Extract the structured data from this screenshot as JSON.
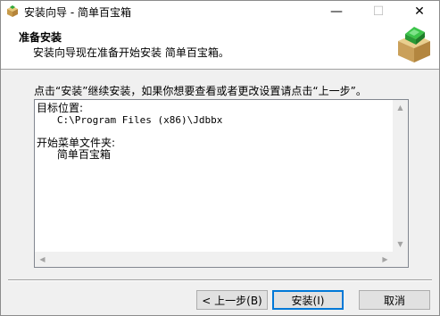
{
  "window": {
    "title": "安装向导 - 简单百宝箱",
    "controls": {
      "minimize": "—",
      "maximize": "☐",
      "close": "✕"
    }
  },
  "header": {
    "title": "准备安装",
    "subtitle": "安装向导现在准备开始安装 简单百宝箱。",
    "logo_icon": "install-box-icon"
  },
  "body": {
    "instruction": "点击“安装”继续安装，如果你想要查看或者更改设置请点击“上一步”。",
    "summary": {
      "dest_label": "目标位置:",
      "dest_value": "C:\\Program Files (x86)\\Jdbbx",
      "start_menu_label": "开始菜单文件夹:",
      "start_menu_value": "简单百宝箱"
    }
  },
  "buttons": {
    "back": "< 上一步(B)",
    "install": "安装(I)",
    "cancel": "取消"
  },
  "colors": {
    "accent": "#0078d7",
    "window_bg": "#f0f0f0",
    "header_bg": "#ffffff"
  }
}
